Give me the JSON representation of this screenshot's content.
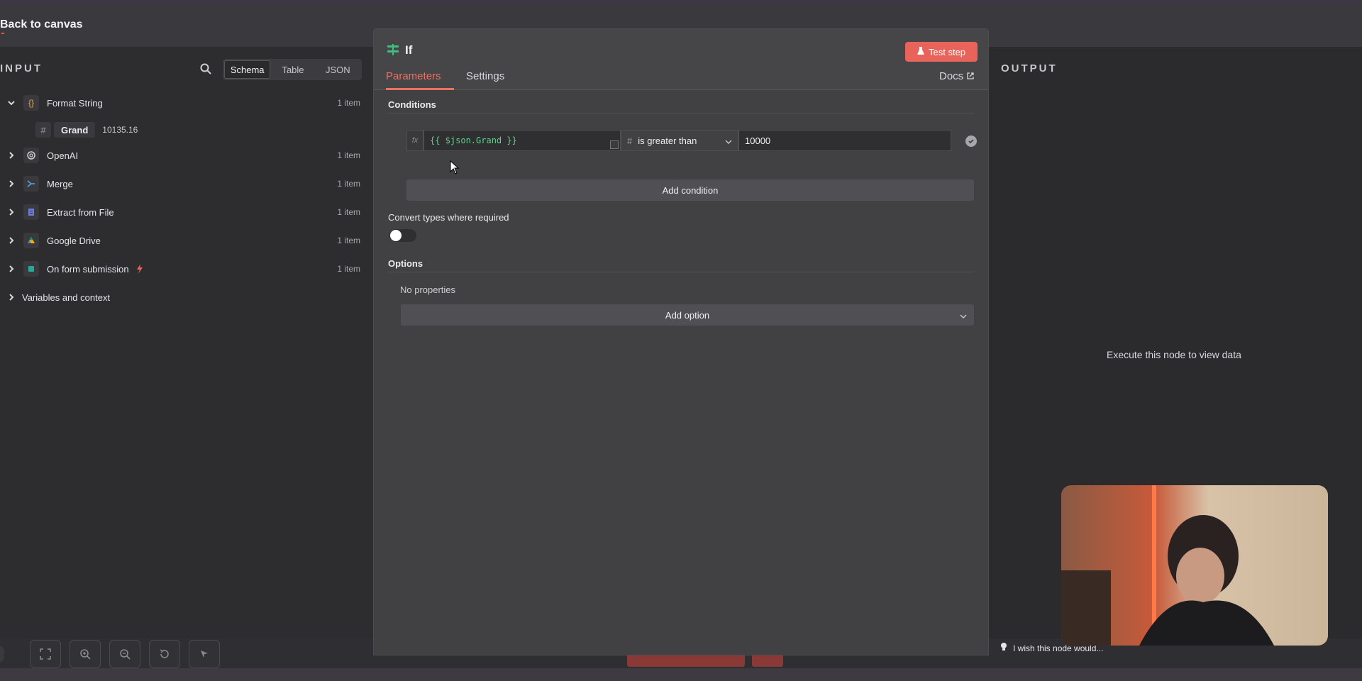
{
  "top": {
    "back_label": "Back to canvas"
  },
  "input_panel": {
    "title": "INPUT",
    "view_options": [
      "Schema",
      "Table",
      "JSON"
    ],
    "active_view": "Schema",
    "nodes": [
      {
        "label": "Format String",
        "icon": "braces-icon",
        "count": "1 item",
        "expanded": true
      },
      {
        "label": "OpenAI",
        "icon": "openai-icon",
        "count": "1 item"
      },
      {
        "label": "Merge",
        "icon": "merge-icon",
        "count": "1 item"
      },
      {
        "label": "Extract from File",
        "icon": "file-icon",
        "count": "1 item"
      },
      {
        "label": "Google Drive",
        "icon": "google-drive-icon",
        "count": "1 item"
      },
      {
        "label": "On form submission",
        "icon": "form-icon",
        "count": "1 item",
        "trigger": true
      }
    ],
    "field": {
      "name": "Grand",
      "value": "10135.16"
    },
    "variables_label": "Variables and context"
  },
  "modal": {
    "node_title": "If",
    "test_button": "Test step",
    "tabs": [
      "Parameters",
      "Settings"
    ],
    "active_tab": "Parameters",
    "docs_label": "Docs",
    "conditions_label": "Conditions",
    "condition": {
      "left_expression": "{{ $json.Grand }}",
      "operator": "is greater than",
      "right_value": "10000"
    },
    "add_condition": "Add condition",
    "convert_label": "Convert types where required",
    "convert_enabled": false,
    "options_label": "Options",
    "no_properties": "No properties",
    "add_option": "Add option"
  },
  "output_panel": {
    "title": "OUTPUT",
    "empty_message": "Execute this node to view data"
  },
  "footer": {
    "feedback_label": "I wish this node would..."
  },
  "colors": {
    "accent": "#ec7060",
    "test_button": "#e8645a",
    "expression": "#5fd08a"
  }
}
